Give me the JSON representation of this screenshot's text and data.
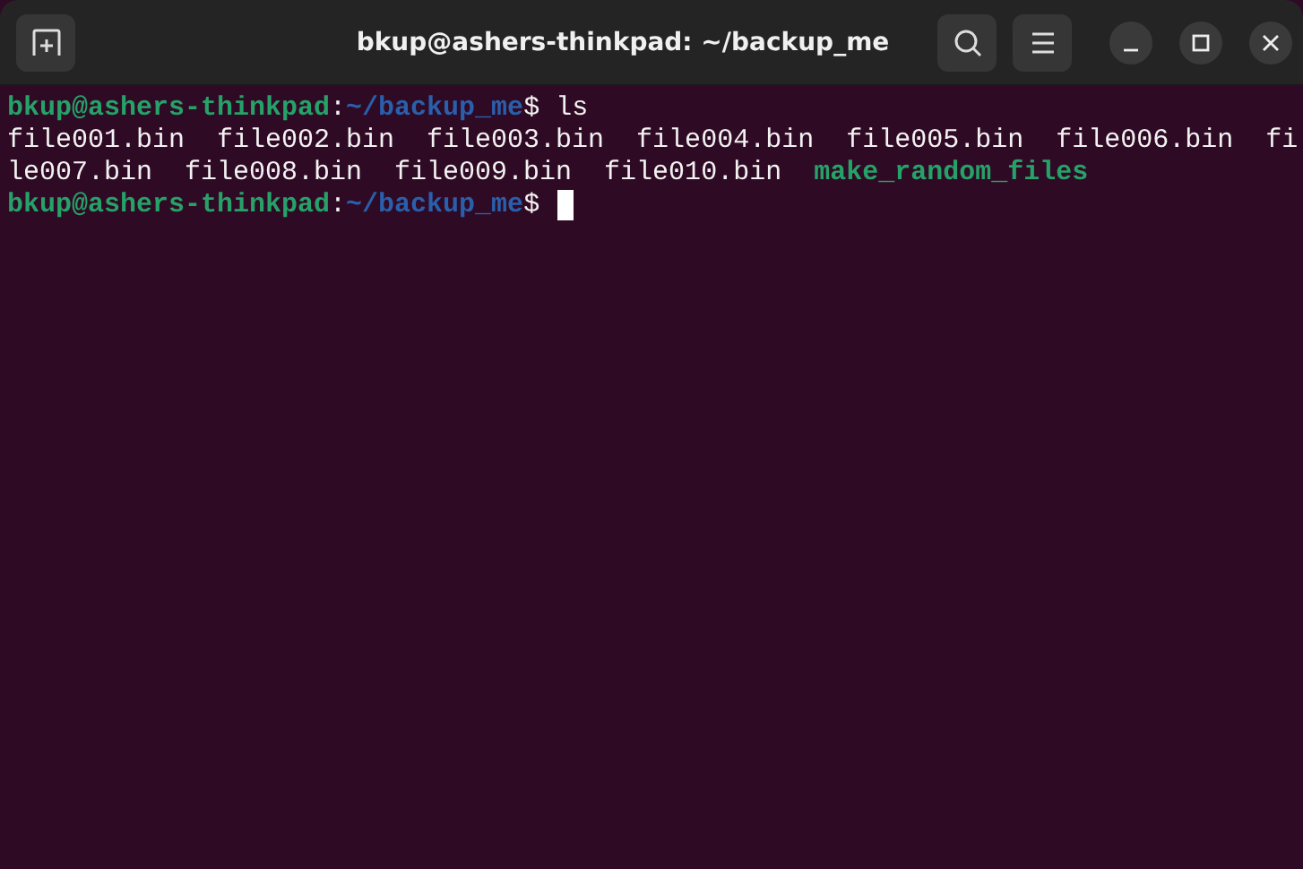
{
  "window": {
    "title": "bkup@ashers-thinkpad: ~/backup_me"
  },
  "terminal": {
    "lines": [
      {
        "segments": [
          {
            "kind": "user_host",
            "text": "bkup@ashers-thinkpad"
          },
          {
            "kind": "separator",
            "text": ":"
          },
          {
            "kind": "path",
            "text": "~/backup_me"
          },
          {
            "kind": "separator",
            "text": "$ "
          },
          {
            "kind": "command",
            "text": "ls"
          }
        ]
      },
      {
        "segments": [
          {
            "kind": "output",
            "text": "file001.bin  file002.bin  file003.bin  file004.bin  file005.bin  file006.bin  fi"
          }
        ]
      },
      {
        "segments": [
          {
            "kind": "output",
            "text": "le007.bin  file008.bin  file009.bin  file010.bin  "
          },
          {
            "kind": "executable",
            "text": "make_random_files"
          }
        ]
      },
      {
        "segments": [
          {
            "kind": "user_host",
            "text": "bkup@ashers-thinkpad"
          },
          {
            "kind": "separator",
            "text": ":"
          },
          {
            "kind": "path",
            "text": "~/backup_me"
          },
          {
            "kind": "separator",
            "text": "$ "
          }
        ],
        "cursor": true
      }
    ]
  }
}
